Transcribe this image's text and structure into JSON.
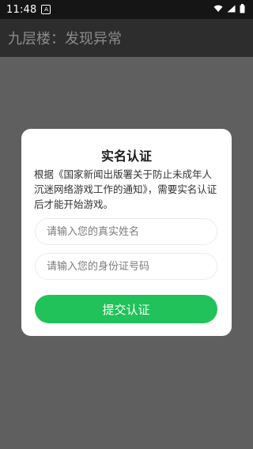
{
  "status_bar": {
    "time": "11:48",
    "notification_icon": "a-letter-icon",
    "wifi_icon": "wifi-icon",
    "signal_icon": "signal-icon",
    "battery_icon": "battery-icon"
  },
  "header": {
    "title": "九层楼：发现异常"
  },
  "dialog": {
    "title": "实名认证",
    "description": "根据《国家新闻出版署关于防止未成年人沉迷网络游戏工作的通知》，需要实名认证后才能开始游戏。",
    "name_placeholder": "请输入您的真实姓名",
    "id_placeholder": "请输入您的身份证号码",
    "name_value": "",
    "id_value": "",
    "submit_label": "提交认证"
  },
  "colors": {
    "overlay": "#5f5f5f",
    "title_bar": "#2d2d2d",
    "status_bar": "#151515",
    "accent": "#21c259"
  }
}
